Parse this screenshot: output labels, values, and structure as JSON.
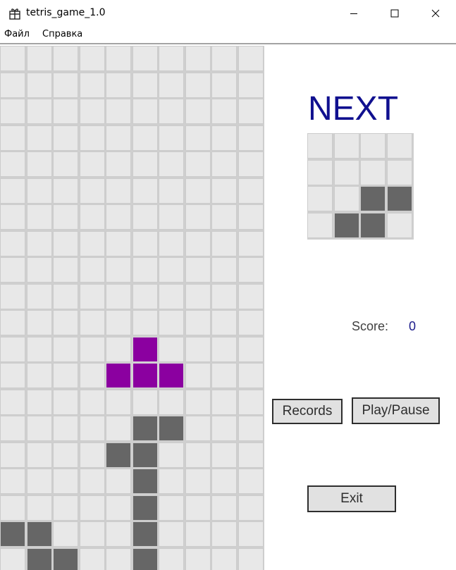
{
  "window": {
    "title": "tetris_game_1.0",
    "controls": [
      "minimize",
      "maximize",
      "close"
    ]
  },
  "menu": {
    "items": [
      "Файл",
      "Справка"
    ]
  },
  "colors": {
    "empty": "#e8e8e8",
    "settled": "#666666",
    "active": "#8b00a0",
    "next_title": "#10108f",
    "score_value": "#1b1b8a"
  },
  "board": {
    "cols": 10,
    "visible_rows": 20,
    "active_piece": {
      "shape": "T",
      "cells": [
        [
          5,
          11
        ],
        [
          4,
          12
        ],
        [
          5,
          12
        ],
        [
          6,
          12
        ]
      ]
    },
    "settled_cells": [
      [
        5,
        14
      ],
      [
        6,
        14
      ],
      [
        4,
        15
      ],
      [
        5,
        15
      ],
      [
        5,
        16
      ],
      [
        5,
        17
      ],
      [
        0,
        18
      ],
      [
        1,
        18
      ],
      [
        5,
        18
      ],
      [
        1,
        19
      ],
      [
        2,
        19
      ],
      [
        5,
        19
      ]
    ]
  },
  "next": {
    "title": "NEXT",
    "cols": 4,
    "rows": 4,
    "cells": [
      [
        2,
        2
      ],
      [
        3,
        2
      ],
      [
        1,
        3
      ],
      [
        2,
        3
      ]
    ]
  },
  "score": {
    "label": "Score:",
    "value": "0"
  },
  "buttons": {
    "records": "Records",
    "play_pause": "Play/Pause",
    "exit": "Exit"
  }
}
